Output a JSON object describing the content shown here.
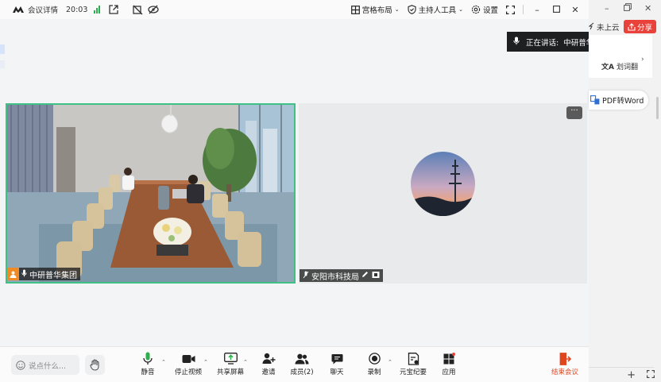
{
  "titlebar": {
    "title": "会议详情",
    "time": "20:03",
    "layout_label": "宫格布局",
    "host_tools_label": "主持人工具",
    "settings_label": "设置"
  },
  "participants": [
    {
      "name": "中研普华集团",
      "is_host": true,
      "video": "camera"
    },
    {
      "name": "安阳市科技局",
      "is_host": false,
      "video": "avatar"
    }
  ],
  "speaking": {
    "prefix": "正在讲话:",
    "name": "中研普华集团"
  },
  "more_button": "···",
  "chat": {
    "placeholder": "说点什么..."
  },
  "toolbar": {
    "mute": "静音",
    "stop_video": "停止视频",
    "share_screen": "共享屏幕",
    "invite": "邀请",
    "members": "成员(2)",
    "chat": "聊天",
    "record": "录制",
    "minutes": "元宝纪要",
    "apps": "应用",
    "end": "结束会议"
  },
  "browser_strip": {
    "cloud_label": "未上云",
    "share_label": "分享",
    "translate_label": "划词翻",
    "pdf_label": "PDF转Word"
  },
  "colors": {
    "active_border": "#3fc186",
    "end_meeting": "#e0461e",
    "share_red": "#e9423a",
    "host_badge": "#f08a24"
  }
}
